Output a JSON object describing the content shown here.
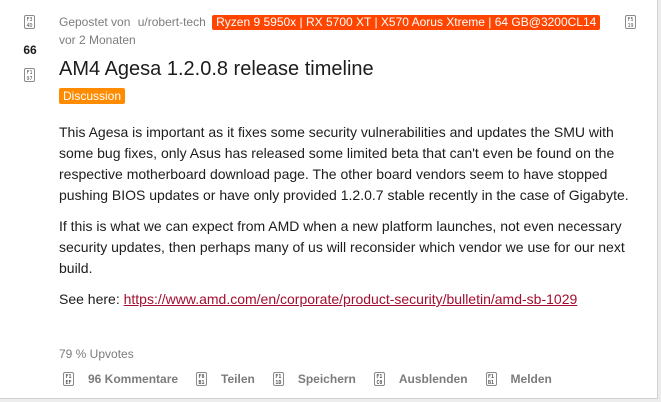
{
  "post": {
    "score": "66",
    "posted_by_prefix": "Gepostet von",
    "author": "u/robert-tech",
    "author_flair": "Ryzen 9 5950x | RX 5700 XT | X570 Aorus Xtreme | 64 GB@3200CL14",
    "time": "vor 2 Monaten",
    "title": "AM4 Agesa 1.2.0.8 release timeline",
    "tag": "Discussion",
    "paragraphs": [
      "This Agesa is important as it fixes some security vulnerabilities and updates the SMU with some bug fixes, only Asus has released some limited beta that can't even be found on the respective motherboard download page. The other board vendors seem to have stopped pushing BIOS updates or have only provided 1.2.0.7 stable recently in the case of Gigabyte.",
      "If this is what we can expect from AMD when a new platform launches, not even necessary security updates, then perhaps many of us will reconsider which vendor we use for our next build."
    ],
    "see_here_label": "See here:",
    "link": "https://www.amd.com/en/corporate/product-security/bulletin/amd-sb-1029",
    "upvote_ratio": "79 % Upvotes"
  },
  "icons": {
    "upvote": "F3\n4D",
    "downvote": "F1\n97",
    "corner": "F5\n19",
    "comments": "F1\nEF",
    "share": "F8\nB1",
    "save": "F1\n1D",
    "hide": "F1\nC0",
    "report": "F1\nB1"
  },
  "actions": {
    "comments": "96 Kommentare",
    "share": "Teilen",
    "save": "Speichern",
    "hide": "Ausblenden",
    "report": "Melden"
  }
}
